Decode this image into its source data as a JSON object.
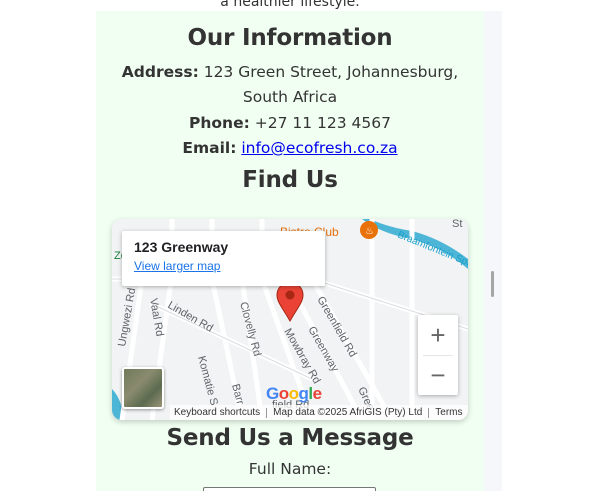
{
  "header_text": "a healthier lifestyle.",
  "info": {
    "title": "Our Information",
    "address_label": "Address:",
    "address_value": " 123 Green Street, Johannesburg, South Africa",
    "phone_label": "Phone:",
    "phone_value": " +27 11 123 4567",
    "email_label": "Email:",
    "email_link": "info@ecofresh.co.za"
  },
  "find": {
    "title": "Find Us",
    "map": {
      "popup_title": "123 Greenway",
      "popup_link": "View larger map",
      "zoom_in": "+",
      "zoom_out": "−",
      "google_logo": "Google",
      "attribution": {
        "shortcuts": "Keyboard shortcuts",
        "data": "Map data ©2025 AfriGIS (Pty) Ltd",
        "terms": "Terms"
      },
      "labels": {
        "club": "Bistro Club",
        "braamfontein": "Braamfontein Spruit",
        "ungwezi": "Ungwezi Rd",
        "vaal": "Vaal Rd",
        "linden": "Linden Rd",
        "clovelly": "Clovelly Rd",
        "greenfield": "Greenfield Rd",
        "greenway": "Greenway",
        "mowbray": "Mowbray Rd",
        "komatie": "Komatie S",
        "barr": "Barr",
        "field": "field Rd",
        "gree": "Gree",
        "zer": "Zer",
        "st": "St"
      },
      "icons": {
        "pin": "map-pin-icon",
        "restaurant": "restaurant-icon"
      },
      "colors": {
        "pin": "#ea4335",
        "water": "#4db6d6",
        "club": "#e8710a"
      }
    }
  },
  "message": {
    "title": "Send Us a Message",
    "full_name_label": "Full Name:",
    "full_name_value": ""
  }
}
